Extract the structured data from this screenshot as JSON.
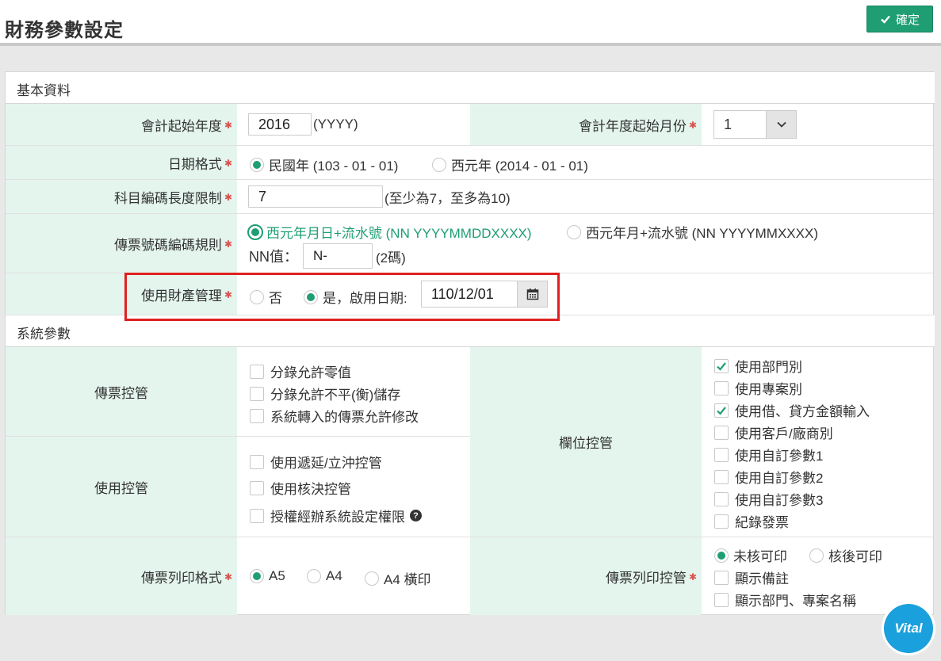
{
  "header": {
    "title": "財務參數設定",
    "confirm_label": "確定"
  },
  "sections": {
    "basic": "基本資料",
    "system": "系統參數"
  },
  "fiscal_start_year": {
    "label": "會計起始年度",
    "value": "2016",
    "hint": "(YYYY)"
  },
  "fiscal_start_month": {
    "label": "會計年度起始月份",
    "value": "1"
  },
  "date_format": {
    "label": "日期格式",
    "options": [
      "民國年 (103 - 01 - 01)",
      "西元年 (2014 - 01 - 01)"
    ],
    "selected": 0
  },
  "account_code_length": {
    "label": "科目編碼長度限制",
    "value": "7",
    "hint": "(至少為7，至多為10)"
  },
  "voucher_numbering": {
    "label": "傳票號碼編碼規則",
    "options": [
      "西元年月日+流水號 (NN YYYYMMDDXXXX)",
      "西元年月+流水號 (NN YYYYMMXXXX)"
    ],
    "selected": 0,
    "nn_label": "NN值：",
    "nn_value": "N-",
    "nn_hint": "(2碼)"
  },
  "asset_management": {
    "label": "使用財產管理",
    "no_label": "否",
    "yes_label": "是，啟用日期:",
    "date": "110/12/01",
    "selected": "yes"
  },
  "voucher_control": {
    "label": "傳票控管",
    "items": [
      "分錄允許零值",
      "分錄允許不平(衡)儲存",
      "系統轉入的傳票允許修改"
    ]
  },
  "usage_control": {
    "label": "使用控管",
    "items": [
      "使用遞延/立沖控管",
      "使用核決控管",
      "授權經辦系統設定權限"
    ]
  },
  "field_control": {
    "label": "欄位控管",
    "items": [
      "使用部門別",
      "使用專案別",
      "使用借、貸方金額輸入",
      "使用客戶/廠商別",
      "使用自訂參數1",
      "使用自訂參數2",
      "使用自訂參數3",
      "紀錄發票"
    ],
    "checked": [
      true,
      false,
      true,
      false,
      false,
      false,
      false,
      false
    ]
  },
  "print_format": {
    "label": "傳票列印格式",
    "options": [
      "A5",
      "A4",
      "A4 橫印"
    ],
    "selected": 0
  },
  "print_control": {
    "label": "傳票列印控管",
    "radio_options": [
      "未核可印",
      "核後可印"
    ],
    "selected": 0,
    "items": [
      "顯示備註",
      "顯示部門、專案名稱"
    ]
  },
  "brand": {
    "logo_text": "Vital"
  },
  "colors": {
    "accent": "#1f9e73",
    "label_bg": "#e4f5ee",
    "highlight": "#e02020"
  }
}
